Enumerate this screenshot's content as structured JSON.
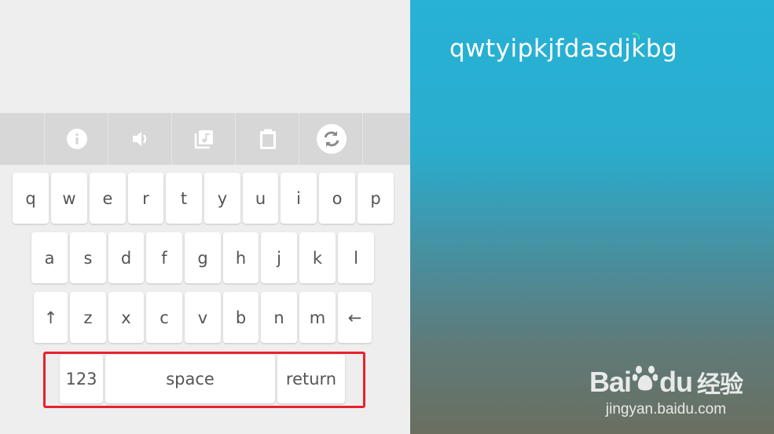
{
  "editor": {
    "typed_text": "qwtyipkjfdasdjkbg"
  },
  "toolbar": {
    "buttons": [
      {
        "name": "info",
        "icon": "info-icon"
      },
      {
        "name": "sound",
        "icon": "speaker-icon"
      },
      {
        "name": "music",
        "icon": "music-library-icon"
      },
      {
        "name": "clipboard",
        "icon": "clipboard-icon"
      },
      {
        "name": "refresh",
        "icon": "refresh-icon"
      }
    ]
  },
  "keyboard": {
    "row1": [
      "q",
      "w",
      "e",
      "r",
      "t",
      "y",
      "u",
      "i",
      "o",
      "p"
    ],
    "row2": [
      "a",
      "s",
      "d",
      "f",
      "g",
      "h",
      "j",
      "k",
      "l"
    ],
    "row3": [
      "↑",
      "z",
      "x",
      "c",
      "v",
      "b",
      "n",
      "m",
      "←"
    ],
    "row4": {
      "numbers_label": "123",
      "space_label": "space",
      "return_label": "return"
    }
  },
  "watermark": {
    "logo_text": "Bai",
    "logo_text_after": "du",
    "logo_cn": "经验",
    "url": "jingyan.baidu.com"
  },
  "colors": {
    "accent_highlight": "#e8222c",
    "right_panel_top": "#27b2d6",
    "right_panel_bottom": "#6a6f60",
    "cursor": "#3fe0a0"
  }
}
